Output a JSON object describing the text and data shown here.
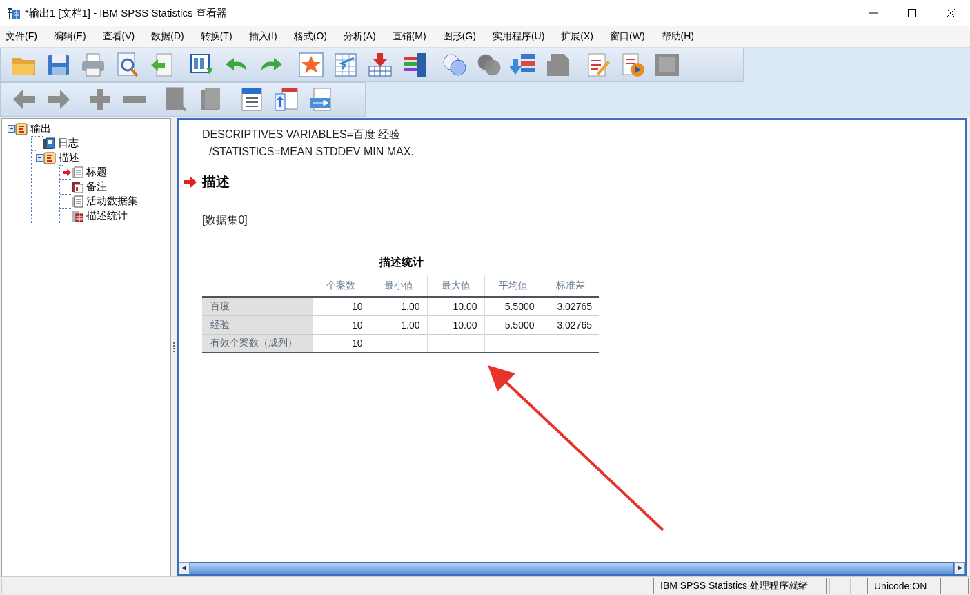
{
  "window": {
    "title": "*输出1 [文档1] - IBM SPSS Statistics 查看器"
  },
  "menu": [
    "文件(F)",
    "编辑(E)",
    "查看(V)",
    "数据(D)",
    "转换(T)",
    "插入(I)",
    "格式(O)",
    "分析(A)",
    "直销(M)",
    "图形(G)",
    "实用程序(U)",
    "扩展(X)",
    "窗口(W)",
    "帮助(H)"
  ],
  "toolbar_1": [
    {
      "kind": "open",
      "disabled": false
    },
    {
      "kind": "save",
      "disabled": false
    },
    {
      "kind": "print",
      "disabled": false
    },
    {
      "kind": "preview",
      "disabled": false
    },
    {
      "kind": "export",
      "disabled": false
    },
    {
      "kind": "recall",
      "disabled": false
    },
    {
      "kind": "undo",
      "disabled": false
    },
    {
      "kind": "redo",
      "disabled": false
    },
    {
      "kind": "star",
      "disabled": false
    },
    {
      "kind": "grid",
      "disabled": false
    },
    {
      "kind": "insert",
      "disabled": false
    },
    {
      "kind": "bars",
      "disabled": false
    },
    {
      "kind": "circles",
      "disabled": false
    },
    {
      "kind": "circles",
      "disabled": true
    },
    {
      "kind": "list",
      "disabled": false
    },
    {
      "kind": "document",
      "disabled": true
    },
    {
      "kind": "edit",
      "disabled": false
    },
    {
      "kind": "play",
      "disabled": false
    },
    {
      "kind": "square",
      "disabled": true
    }
  ],
  "toolbar_2": [
    {
      "kind": "back",
      "disabled": true
    },
    {
      "kind": "forward",
      "disabled": true
    },
    {
      "kind": "plus",
      "disabled": true
    },
    {
      "kind": "minus",
      "disabled": true
    },
    {
      "kind": "preview",
      "disabled": true
    },
    {
      "kind": "book",
      "disabled": true
    },
    {
      "kind": "title",
      "disabled": false
    },
    {
      "kind": "promote",
      "disabled": false
    },
    {
      "kind": "move",
      "disabled": false
    }
  ],
  "outline": [
    {
      "label": "输出",
      "kind": "book",
      "expanded": true,
      "current": false,
      "children": [
        {
          "label": "日志",
          "kind": "log",
          "current": false
        },
        {
          "label": "描述",
          "kind": "book",
          "expanded": true,
          "current": false,
          "children": [
            {
              "label": "标题",
              "kind": "title",
              "current": true
            },
            {
              "label": "备注",
              "kind": "notes",
              "current": false
            },
            {
              "label": "活动数据集",
              "kind": "text",
              "current": false
            },
            {
              "label": "描述统计",
              "kind": "table",
              "current": false
            }
          ]
        }
      ]
    }
  ],
  "output": {
    "syntax": [
      "DESCRIPTIVES VARIABLES=百度 经验",
      "/STATISTICS=MEAN STDDEV MIN MAX."
    ],
    "heading": "描述",
    "dataset": "[数据集0]",
    "table": {
      "title": "描述统计",
      "columns": [
        "",
        "个案数",
        "最小值",
        "最大值",
        "平均值",
        "标准差"
      ],
      "rows": [
        [
          "百度",
          "10",
          "1.00",
          "10.00",
          "5.5000",
          "3.02765"
        ],
        [
          "经验",
          "10",
          "1.00",
          "10.00",
          "5.5000",
          "3.02765"
        ],
        [
          "有效个案数（成列）",
          "10",
          "",
          "",
          "",
          ""
        ]
      ]
    }
  },
  "status_bar": [
    "IBM SPSS Statistics 处理程序就绪",
    "Unicode:ON"
  ]
}
